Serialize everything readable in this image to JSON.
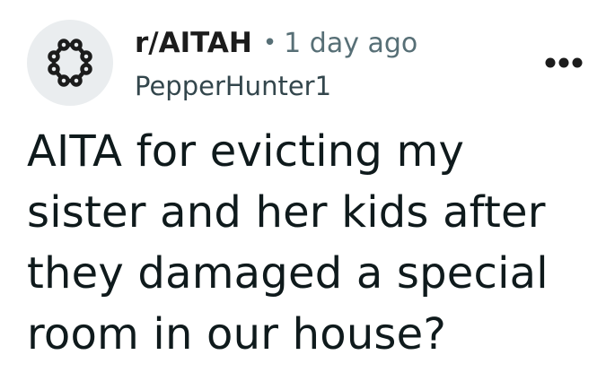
{
  "post": {
    "subreddit": "r/AITAH",
    "separator": "•",
    "time_ago": "1 day ago",
    "author": "PepperHunter1",
    "title": "AITA for evicting my sister and her kids after they damaged a special room in our house?"
  },
  "icons": {
    "subreddit_avatar": "ring-of-circles-icon",
    "overflow_menu": "horizontal-ellipsis-icon"
  },
  "colors": {
    "avatar_background": "#eaedef",
    "meta_text": "#576f76",
    "title_text": "#0f1a1c"
  }
}
